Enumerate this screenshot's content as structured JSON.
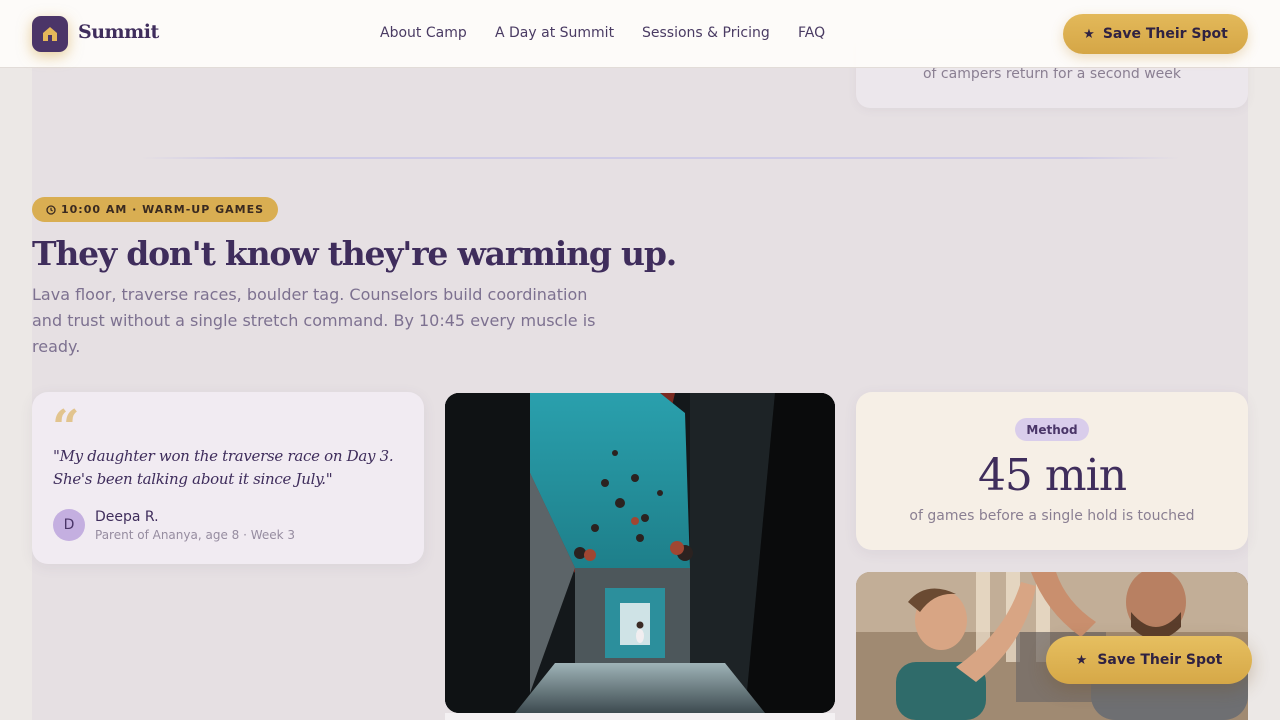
{
  "brand": {
    "name": "Summit"
  },
  "nav": {
    "links": [
      "About Camp",
      "A Day at Summit",
      "Sessions & Pricing",
      "FAQ"
    ],
    "cta_label": "Save Their Spot",
    "cta_icon": "star-icon"
  },
  "top_stat": {
    "caption": "of campers return for a second week"
  },
  "section": {
    "badge": "10:00 AM · WARM-UP GAMES",
    "headline": "They don't know they're warming up.",
    "lede": "Lava floor, traverse races, boulder tag. Counselors build coordination and trust without a single stretch command. By 10:45 every muscle is ready."
  },
  "testimonial": {
    "quote_mark": "“",
    "quote": "\"My daughter won the traverse race on Day 3. She's been talking about it since July.\"",
    "avatar_initial": "D",
    "author": "Deepa R.",
    "author_detail": "Parent of Ananya, age 8 · Week 3"
  },
  "method": {
    "pill": "Method",
    "value": "45 min",
    "caption": "of games before a single hold is touched"
  },
  "floating_cta": {
    "label": "Save Their Spot"
  },
  "colors": {
    "brand_purple": "#3f2d5c",
    "gold": "#d9ae52",
    "lavender": "#d9cdeb",
    "cream": "#f6efe6"
  }
}
